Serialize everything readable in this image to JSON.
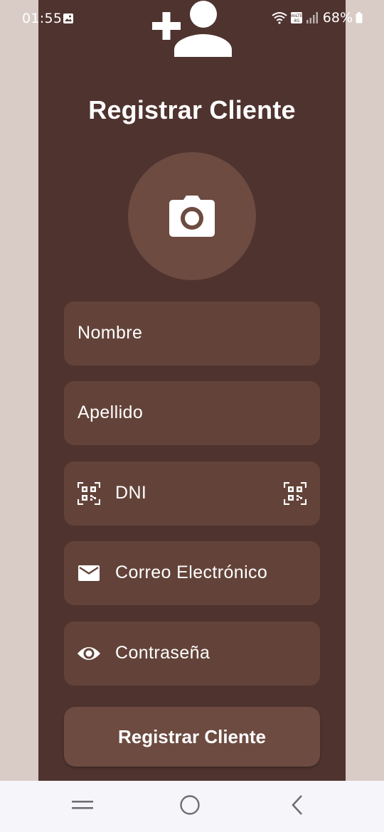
{
  "status_bar": {
    "time": "01:55",
    "battery": "68%",
    "icons": [
      "gallery-icon",
      "wifi-icon",
      "volte-icon",
      "signal-icon",
      "battery-icon"
    ]
  },
  "header": {
    "icon": "person-add-icon",
    "title": "Registrar Cliente"
  },
  "photo": {
    "icon": "camera-icon"
  },
  "form": {
    "nombre_label": "Nombre",
    "apellido_label": "Apellido",
    "dni_label": "DNI",
    "correo_label": "Correo Electrónico",
    "contrasena_label": "Contraseña",
    "dni_icon": "qr-icon",
    "dni_trailing_icon": "qr-scan-icon",
    "correo_icon": "mail-icon",
    "contrasena_icon": "eye-icon"
  },
  "submit": {
    "label": "Registrar Cliente"
  },
  "nav": {
    "items": [
      "recent-apps-icon",
      "home-icon",
      "back-icon"
    ]
  },
  "colors": {
    "page_background": "#d9ccc7",
    "card_background": "#4f332f",
    "field_background": "#634339",
    "accent": "#6d4b41",
    "text": "#ffffff",
    "nav_background": "#f6f5f9"
  }
}
